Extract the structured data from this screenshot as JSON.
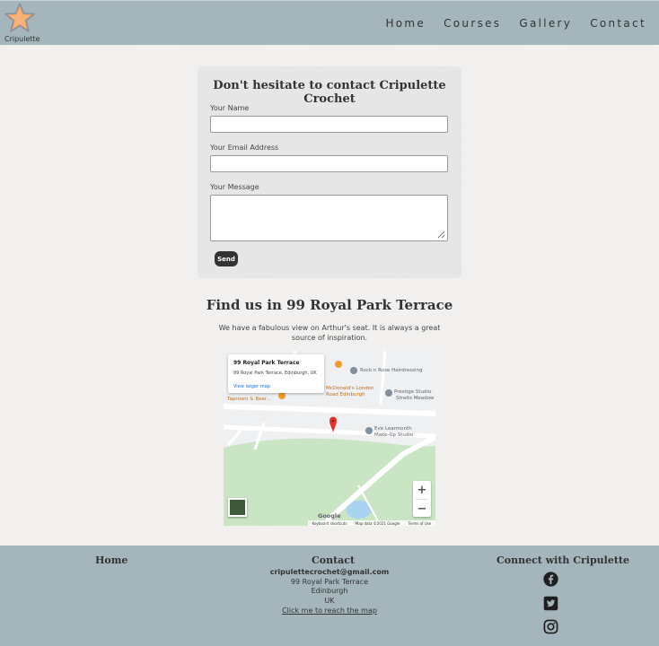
{
  "header": {
    "brand": "Cripulette",
    "nav": [
      "Home",
      "Courses",
      "Gallery",
      "Contact"
    ]
  },
  "form": {
    "title": "Don't hesitate to contact Cripulette Crochet",
    "name_label": "Your Name",
    "email_label": "Your Email Address",
    "message_label": "Your Message",
    "name_value": "",
    "email_value": "",
    "message_value": "",
    "send_label": "Send"
  },
  "find": {
    "title": "Find us in 99 Royal Park Terrace",
    "text": "We have a fabulous view on Arthur's seat. It is always a great source of inspiration."
  },
  "map": {
    "place_title": "99 Royal Park Terrace",
    "place_address": "99 Royal Park Terrace, Edinburgh, UK",
    "larger_map": "View larger map",
    "labels": {
      "rock_n_rose": "Rock n Rose Hairdressing",
      "mcdonalds": "McDonald's London",
      "mcdonalds_2": "Road Edinburgh",
      "prestige": "Prestige Studio",
      "straits": "Straits Meadow",
      "taproom": "Taproom & Beer...",
      "eve": "Eve Learmonth",
      "eve_2": "Make-Up Studio",
      "google": "Google"
    },
    "zoom_in": "+",
    "zoom_out": "−",
    "attribution": [
      "Keyboard shortcuts",
      "Map data ©2021 Google",
      "Terms of Use"
    ],
    "colors": {
      "park": "#c9e5c4",
      "water": "#a8d4f2",
      "pin": "#e0342c"
    }
  },
  "footer": {
    "home": "Home",
    "contact_title": "Contact",
    "email": "cripulettecrochet@gmail.com",
    "address1": "99 Royal Park Terrace",
    "address2": "Edinburgh",
    "address3": "UK",
    "map_link": "Click me to reach the map",
    "connect_title": "Connect with Cripulette",
    "social_icons": [
      "facebook-icon",
      "twitter-icon",
      "instagram-icon"
    ]
  },
  "colors": {
    "header_bg": "#a4b6bc",
    "page_bg": "#f3f2f0",
    "card_bg": "#e6e6e6",
    "logo_star": "#f4a261",
    "button_bg": "#333333"
  }
}
